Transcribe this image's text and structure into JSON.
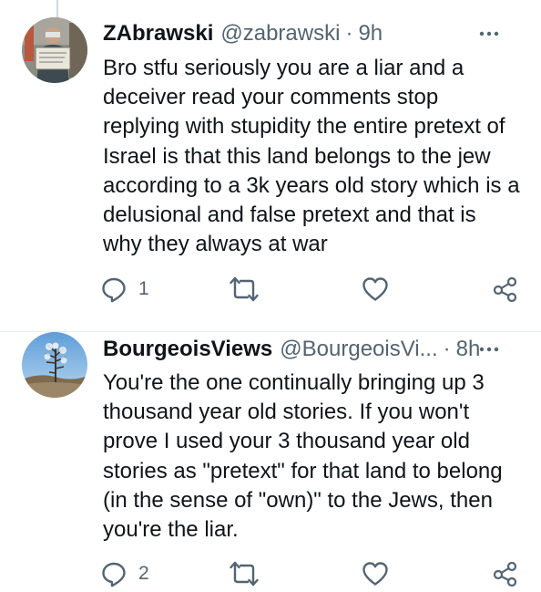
{
  "colors": {
    "text": "#0f1419",
    "muted": "#536471",
    "divider": "#e6ecf0",
    "thread": "#cfd9de"
  },
  "tweets": [
    {
      "name": "ZAbrawski",
      "handle": "@zabrawski",
      "separator": "·",
      "time": "9h",
      "avatar_icon": "person-with-sign-avatar",
      "lines": [
        "Bro stfu seriously you are a liar and a",
        "deceiver read your comments stop",
        "replying with stupidity the entire pretext of",
        "Israel is that this land belongs to the jew",
        "according to a 3k years old story which is a",
        "delusional and false pretext and that is",
        "why they always at war"
      ],
      "reply_count": "1",
      "retweet_count": "",
      "like_count": ""
    },
    {
      "name": "BourgeoisViews",
      "handle": "@BourgeoisVi...",
      "separator": "·",
      "time": "8h",
      "avatar_icon": "winter-tree-avatar",
      "lines": [
        "You're the one continually bringing up 3",
        "thousand year old stories. If you won't",
        "prove I used your 3 thousand year old",
        "stories as \"pretext\" for that land to belong",
        "(in the sense of \"own)\" to the Jews, then",
        "you're the liar."
      ],
      "reply_count": "2",
      "retweet_count": "",
      "like_count": ""
    }
  ]
}
